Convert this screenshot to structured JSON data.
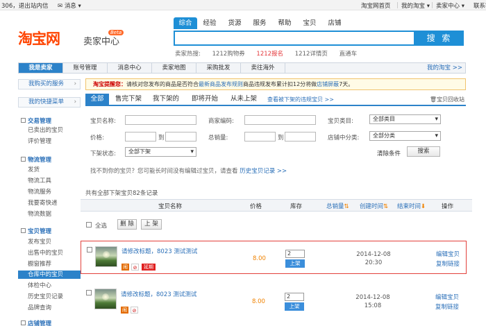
{
  "topbar": {
    "user": "306，退出",
    "site_msg": "站内信",
    "messages": "消息 ▾",
    "home": "淘宝网首页",
    "my_taobao": "我的淘宝 ▾",
    "seller_center": "卖家中心 ▾",
    "contact": "联系客服 ▾"
  },
  "header": {
    "logo": "淘宝网",
    "logo_sub": "卖家中心",
    "beta": "Beta"
  },
  "search": {
    "tabs": [
      "综合",
      "经验",
      "货源",
      "服务",
      "帮助",
      "宝贝",
      "店铺"
    ],
    "button": "搜 索",
    "hot_label": "卖家热搜:",
    "hot": [
      "1212购物券",
      "1212报名",
      "1212详情页",
      "直通车"
    ]
  },
  "nav": {
    "items": [
      "我是卖家",
      "账号管理",
      "消息中心",
      "卖家地图",
      "采购批发",
      "卖往海外"
    ],
    "my_taobao": "我的淘宝 >>"
  },
  "sidebar": {
    "bars": [
      "我购买的服务",
      "我的快捷菜单"
    ],
    "groups": [
      {
        "title": "交易管理",
        "items": [
          "已卖出的宝贝",
          "评价管理"
        ]
      },
      {
        "title": "物流管理",
        "items": [
          "发货",
          "物流工具",
          "物流服务",
          "我要寄快递",
          "物流数据"
        ]
      },
      {
        "title": "宝贝管理",
        "items": [
          "发布宝贝",
          "出售中的宝贝",
          "橱窗推荐",
          "仓库中的宝贝",
          "体检中心",
          "历史宝贝记录",
          "品牌查询"
        ]
      },
      {
        "title": "店铺管理",
        "items": []
      }
    ]
  },
  "notice": {
    "label": "淘宝提醒您：",
    "text": "请核对您发布的商品是否符合",
    "link1": "最新商品发布规则",
    "text2": "商品违规发布累计扣12分将做",
    "link2": "店铺屏蔽",
    "text3": "7天。"
  },
  "filter_tabs": {
    "items": [
      "全部",
      "售完下架",
      "我下架的",
      "即将开始",
      "从未上架"
    ],
    "link": "查看被下架的违规宝贝 >>",
    "recycle": "宝贝回收站"
  },
  "form": {
    "item_name": "宝贝名称:",
    "merchant_code": "商家编码:",
    "category": "宝贝类目:",
    "category_value": "全部类目",
    "price": "价格:",
    "to1": "到",
    "total_sales": "总销量:",
    "to2": "到",
    "shop_category": "店铺中分类:",
    "shop_category_value": "全部分类",
    "status": "下架状态:",
    "status_value": "全部下架",
    "clear": "清除条件",
    "search": "搜索"
  },
  "hint": {
    "text": "找不到你的宝贝？您可能长时间没有编辑过宝贝，请查看",
    "link": "历史宝贝记录 >>"
  },
  "count_text": "共有全部下架宝贝82条记录",
  "table": {
    "headers": [
      "宝贝名称",
      "价格",
      "库存",
      "总销量",
      "创建时间",
      "结束时间",
      "操作"
    ],
    "select_all": "全选",
    "delete": "删 除",
    "list": "上 架",
    "rows": [
      {
        "title": "请修改标题，8023 测试测试",
        "price": "8.00",
        "stock": "2",
        "up": "上架",
        "date": "2014-12-08",
        "time": "20:30",
        "edit": "编辑宝贝",
        "copy": "复制链接",
        "tags": [
          "闹",
          "",
          "延期"
        ]
      },
      {
        "title": "请修改标题，8023 测试测试",
        "price": "8.00",
        "stock": "2",
        "up": "上架",
        "date": "2014-12-08",
        "time": "15:08",
        "edit": "编辑宝贝",
        "copy": "复制链接",
        "tags": [
          "闹",
          ""
        ]
      }
    ]
  },
  "colors": {
    "brand": "#ff4400",
    "accent": "#2c82c9",
    "link": "#2a6fb8",
    "price": "#f08200",
    "highlight_border": "#e2403a"
  }
}
